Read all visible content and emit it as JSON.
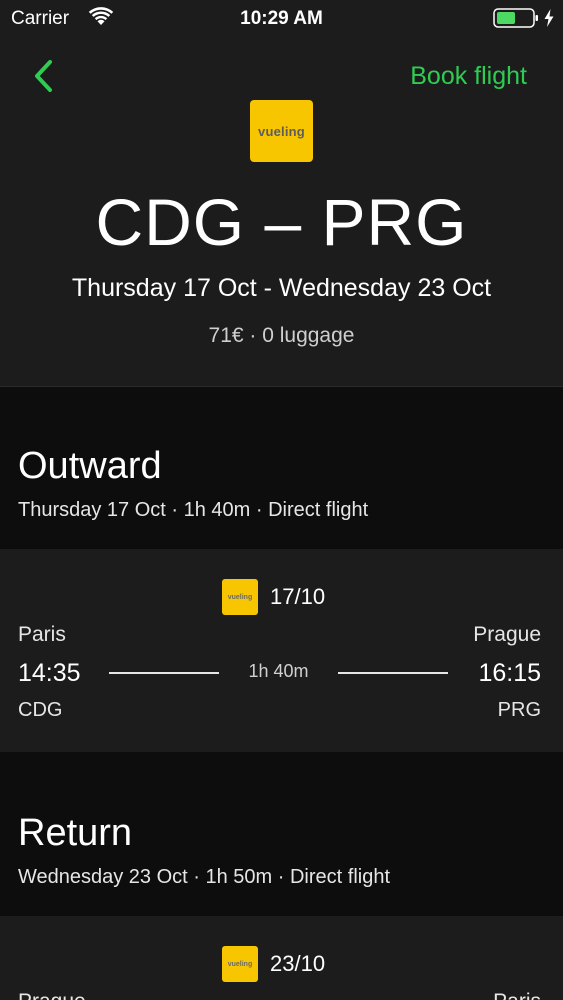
{
  "status_bar": {
    "carrier": "Carrier",
    "time": "10:29 AM",
    "battery_color": "#4cd964"
  },
  "header": {
    "back_icon": "chevron-left-icon",
    "book_label": "Book flight",
    "accent_color": "#2ecc52",
    "airline_logo_text": "vueling",
    "airline_color": "#f7c600",
    "route": "CDG – PRG",
    "dates": "Thursday 17 Oct - Wednesday 23 Oct",
    "price_info": "71€ · 0 luggage"
  },
  "outward": {
    "heading": "Outward",
    "summary": "Thursday 17 Oct · 1h 40m · Direct flight",
    "card": {
      "logo_text": "vueling",
      "date": "17/10",
      "from_city": "Paris",
      "to_city": "Prague",
      "depart_time": "14:35",
      "arrive_time": "16:15",
      "duration": "1h 40m",
      "from_code": "CDG",
      "to_code": "PRG"
    }
  },
  "return": {
    "heading": "Return",
    "summary": "Wednesday 23 Oct · 1h 50m · Direct flight",
    "card": {
      "logo_text": "vueling",
      "date": "23/10",
      "from_city": "Prague",
      "to_city": "Paris"
    }
  }
}
